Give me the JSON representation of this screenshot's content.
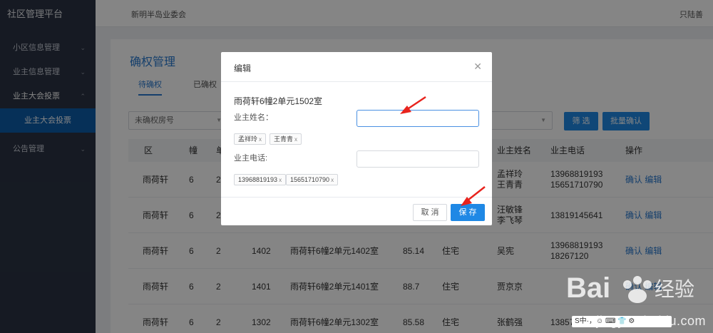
{
  "sidebar": {
    "brand": "社区管理平台",
    "items": [
      {
        "label": "小区信息管理",
        "chevron": "⌄"
      },
      {
        "label": "业主信息管理",
        "chevron": "⌄"
      },
      {
        "label": "业主大会投票",
        "chevron": "⌃"
      },
      {
        "label": "业主大会投票"
      },
      {
        "label": "公告管理",
        "chevron": "⌄"
      }
    ]
  },
  "header": {
    "org": "新明半岛业委会",
    "user": "只陆善"
  },
  "page": {
    "title": "确权管理",
    "tabs": [
      "待确权",
      "已确权"
    ],
    "filter_placeholder": "未确权房号",
    "filter_button": "筛 选",
    "batch_button": "批量确认"
  },
  "table": {
    "headers": [
      "区",
      "幢",
      "单",
      "业主姓名",
      "业主电话",
      "操作"
    ],
    "rows": [
      {
        "area": "雨荷轩",
        "bldg": "6",
        "unit": "2",
        "room": "",
        "addr": "",
        "size": "",
        "type": "",
        "owner": [
          "孟祥玲",
          "王青青"
        ],
        "phone": [
          "13968819193",
          "15651710790"
        ]
      },
      {
        "area": "雨荷轩",
        "bldg": "6",
        "unit": "2",
        "room": "",
        "addr": "",
        "size": "",
        "type": "",
        "owner": [
          "汪敏锋",
          "李飞琴"
        ],
        "phone": [
          "13819145641",
          ""
        ]
      },
      {
        "area": "雨荷轩",
        "bldg": "6",
        "unit": "2",
        "room": "1402",
        "addr": "雨荷轩6幢2单元1402室",
        "size": "85.14",
        "type": "住宅",
        "owner": [
          "吴宪",
          ""
        ],
        "phone": [
          "13968819193",
          "18267120"
        ]
      },
      {
        "area": "雨荷轩",
        "bldg": "6",
        "unit": "2",
        "room": "1401",
        "addr": "雨荷轩6幢2单元1401室",
        "size": "88.7",
        "type": "住宅",
        "owner": [
          "贾京京",
          ""
        ],
        "phone": [
          "",
          ""
        ]
      },
      {
        "area": "雨荷轩",
        "bldg": "6",
        "unit": "2",
        "room": "1302",
        "addr": "雨荷轩6幢2单元1302室",
        "size": "85.58",
        "type": "住宅",
        "owner": [
          "张鹤强",
          ""
        ],
        "phone": [
          "13857135579",
          ""
        ]
      }
    ],
    "action_confirm": "确认",
    "action_edit": "编辑"
  },
  "modal": {
    "title": "编辑",
    "room": "雨荷轩6幢2单元1502室",
    "name_label": "业主姓名：",
    "name_tags": [
      "孟祥玲",
      "王青青"
    ],
    "phone_label": "业主电话:",
    "phone_tags": [
      "13968819193",
      "15651710790"
    ],
    "tag_remove": "x",
    "cancel": "取 消",
    "save": "保 存"
  },
  "watermark": {
    "url": "jingyan.baidu.com"
  },
  "ime": {
    "text": "S中·，☺ ⌨ 👕 ⚙"
  },
  "colors": {
    "primary": "#1f88e5",
    "sidebar": "#2b3343",
    "sidebar_active": "#0d5ca9",
    "arrow": "#e8231d"
  }
}
